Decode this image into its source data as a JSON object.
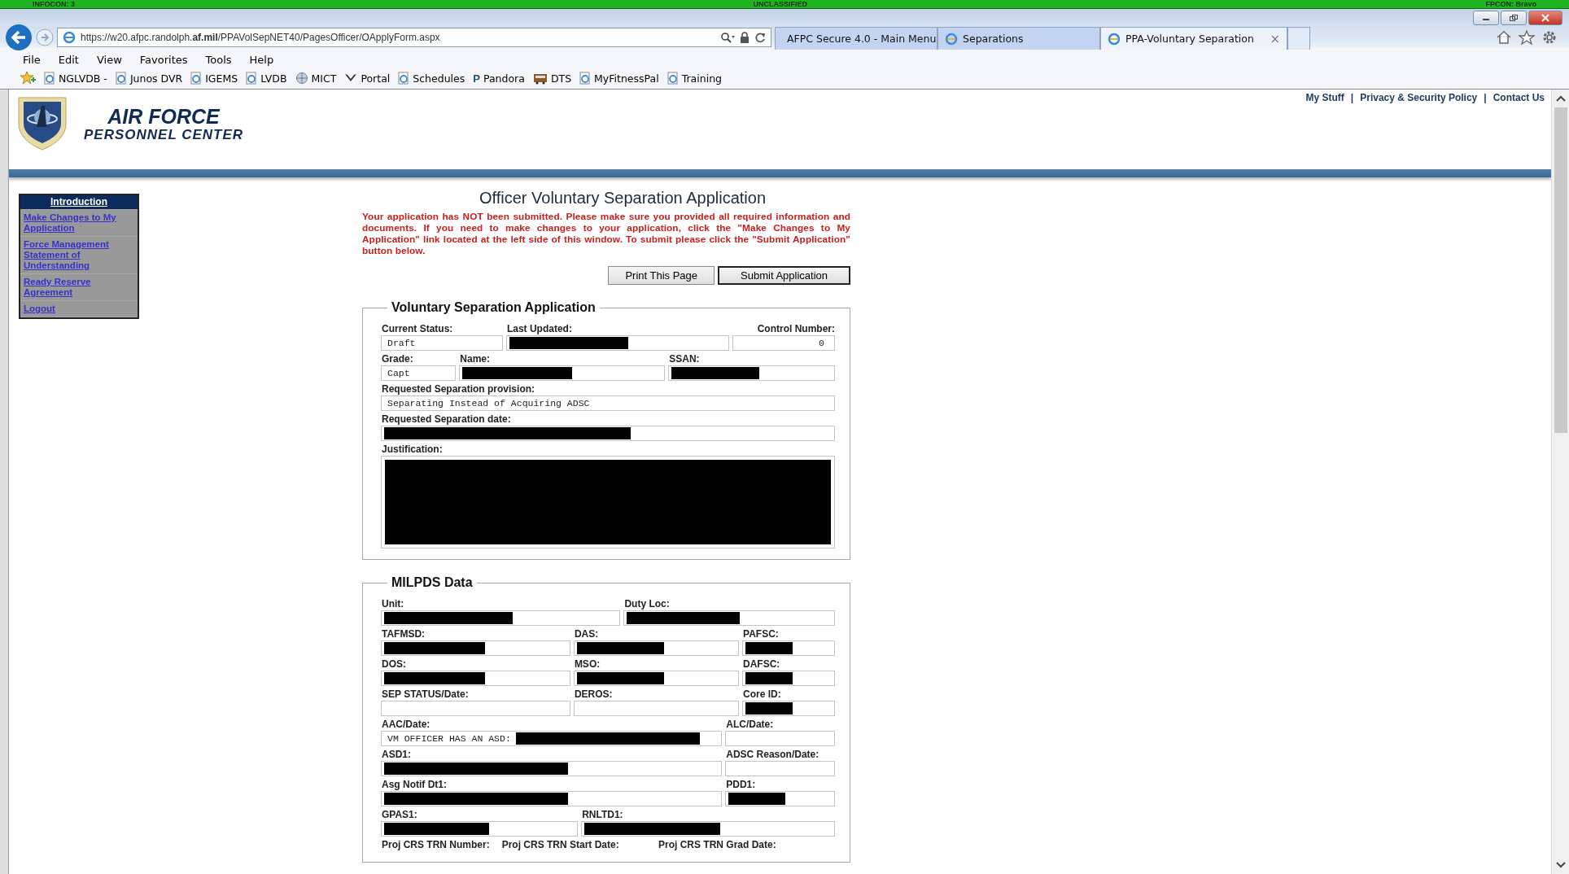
{
  "status_strip": {
    "left": "INFOCON: 3",
    "center": "UNCLASSIFIED",
    "right": "FPCON: Bravo"
  },
  "browser": {
    "address": "https://w20.afpc.randolph.**af.mil**/PPAVolSepNET40/PagesOfficer/OApplyForm.aspx",
    "tabs": [
      {
        "label": "AFPC Secure 4.0 - Main Menu",
        "selected": false
      },
      {
        "label": "Separations",
        "selected": false
      },
      {
        "label": "PPA-Voluntary Separation",
        "selected": true,
        "close": "×"
      }
    ],
    "menu": [
      "File",
      "Edit",
      "View",
      "Favorites",
      "Tools",
      "Help"
    ],
    "favorites": [
      {
        "label": "NGLVDB -",
        "kind": "page"
      },
      {
        "label": "Junos DVR",
        "kind": "page"
      },
      {
        "label": "IGEMS",
        "kind": "page"
      },
      {
        "label": "LVDB",
        "kind": "page"
      },
      {
        "label": "MICT",
        "kind": "globe"
      },
      {
        "label": "Portal",
        "kind": "eagle"
      },
      {
        "label": "Schedules",
        "kind": "page"
      },
      {
        "label": "Pandora",
        "kind": "letter",
        "letter": "P"
      },
      {
        "label": "DTS",
        "kind": "bus"
      },
      {
        "label": "MyFitnessPal",
        "kind": "page"
      },
      {
        "label": "Training",
        "kind": "page"
      }
    ]
  },
  "header": {
    "title": "AIR FORCE",
    "subtitle": "PERSONNEL CENTER",
    "links": [
      "My Stuff",
      "Privacy & Security Policy",
      "Contact Us"
    ],
    "separator": "|"
  },
  "sidebar": {
    "items": [
      {
        "label": "Introduction",
        "selected": true
      },
      {
        "label": "Make Changes to My Application",
        "selected": false
      },
      {
        "label": "Force Management Statement of Understanding",
        "selected": false
      },
      {
        "label": "Ready Reserve Agreement",
        "selected": false
      },
      {
        "label": "Logout",
        "selected": false
      }
    ]
  },
  "page": {
    "title": "Officer Voluntary Separation Application",
    "warning": "Your application has NOT been submitted. Please make sure you provided all required information and documents. If you need to make changes to your application, click the \"Make Changes to My Application\" link located at the left side of this window. To submit please click the \"Submit Application\" button below.",
    "buttons": [
      {
        "label": "Print This Page",
        "default": false
      },
      {
        "label": "Submit Application",
        "default": true
      }
    ]
  },
  "sections": [
    {
      "title": "Voluntary Separation Application",
      "rows": [
        [
          {
            "label": "Current Status:",
            "value": "Draft",
            "redacted": false
          },
          {
            "label": "Last Updated:",
            "redacted": true
          },
          {
            "label": "Control Number:",
            "value": "0",
            "redacted": false,
            "kind": "number"
          }
        ],
        [
          {
            "label": "Grade:",
            "value": "Capt",
            "redacted": false
          },
          {
            "label": "Name:",
            "redacted": true
          },
          {
            "label": "SSAN:",
            "redacted": true
          }
        ],
        [
          {
            "label": "Requested Separation provision:",
            "value": "Separating Instead of Acquiring ADSC",
            "redacted": false
          }
        ],
        [
          {
            "label": "Requested Separation date:",
            "redacted": true
          }
        ],
        [
          {
            "label": "Justification:",
            "redacted": true,
            "kind": "textarea"
          }
        ]
      ]
    },
    {
      "title": "MILPDS Data",
      "rows": [
        [
          {
            "label": "Unit:",
            "redacted": true
          },
          {
            "label": "Duty Loc:",
            "redacted": true
          }
        ],
        [
          {
            "label": "TAFMSD:",
            "redacted": true
          },
          {
            "label": "DAS:",
            "redacted": true
          },
          {
            "label": "PAFSC:",
            "redacted": true
          }
        ],
        [
          {
            "label": "DOS:",
            "redacted": true
          },
          {
            "label": "MSO:",
            "redacted": true
          },
          {
            "label": "DAFSC:",
            "redacted": true
          }
        ],
        [
          {
            "label": "SEP STATUS/Date:",
            "redacted": false
          },
          {
            "label": "DEROS:",
            "redacted": false
          },
          {
            "label": "Core ID:",
            "redacted": true
          }
        ],
        [
          {
            "label": "AAC/Date:",
            "value": "VM OFFICER HAS AN ASD:",
            "redacted": true
          },
          {
            "label": "ALC/Date:",
            "redacted": false
          }
        ],
        [
          {
            "label": "ASD1:",
            "redacted": true
          },
          {
            "label": "ADSC Reason/Date:",
            "redacted": false
          }
        ],
        [
          {
            "label": "Asg Notif Dt1:",
            "redacted": true
          },
          {
            "label": "PDD1:",
            "redacted": true
          }
        ],
        [
          {
            "label": "GPAS1:",
            "redacted": true
          },
          {
            "label": "RNLTD1:",
            "redacted": true
          }
        ],
        [
          {
            "label": "Proj CRS TRN Number:",
            "kind": "label"
          },
          {
            "label": "Proj CRS TRN Start Date:",
            "kind": "label"
          },
          {
            "label": "Proj CRS TRN Grad Date:",
            "kind": "label"
          }
        ]
      ]
    }
  ]
}
